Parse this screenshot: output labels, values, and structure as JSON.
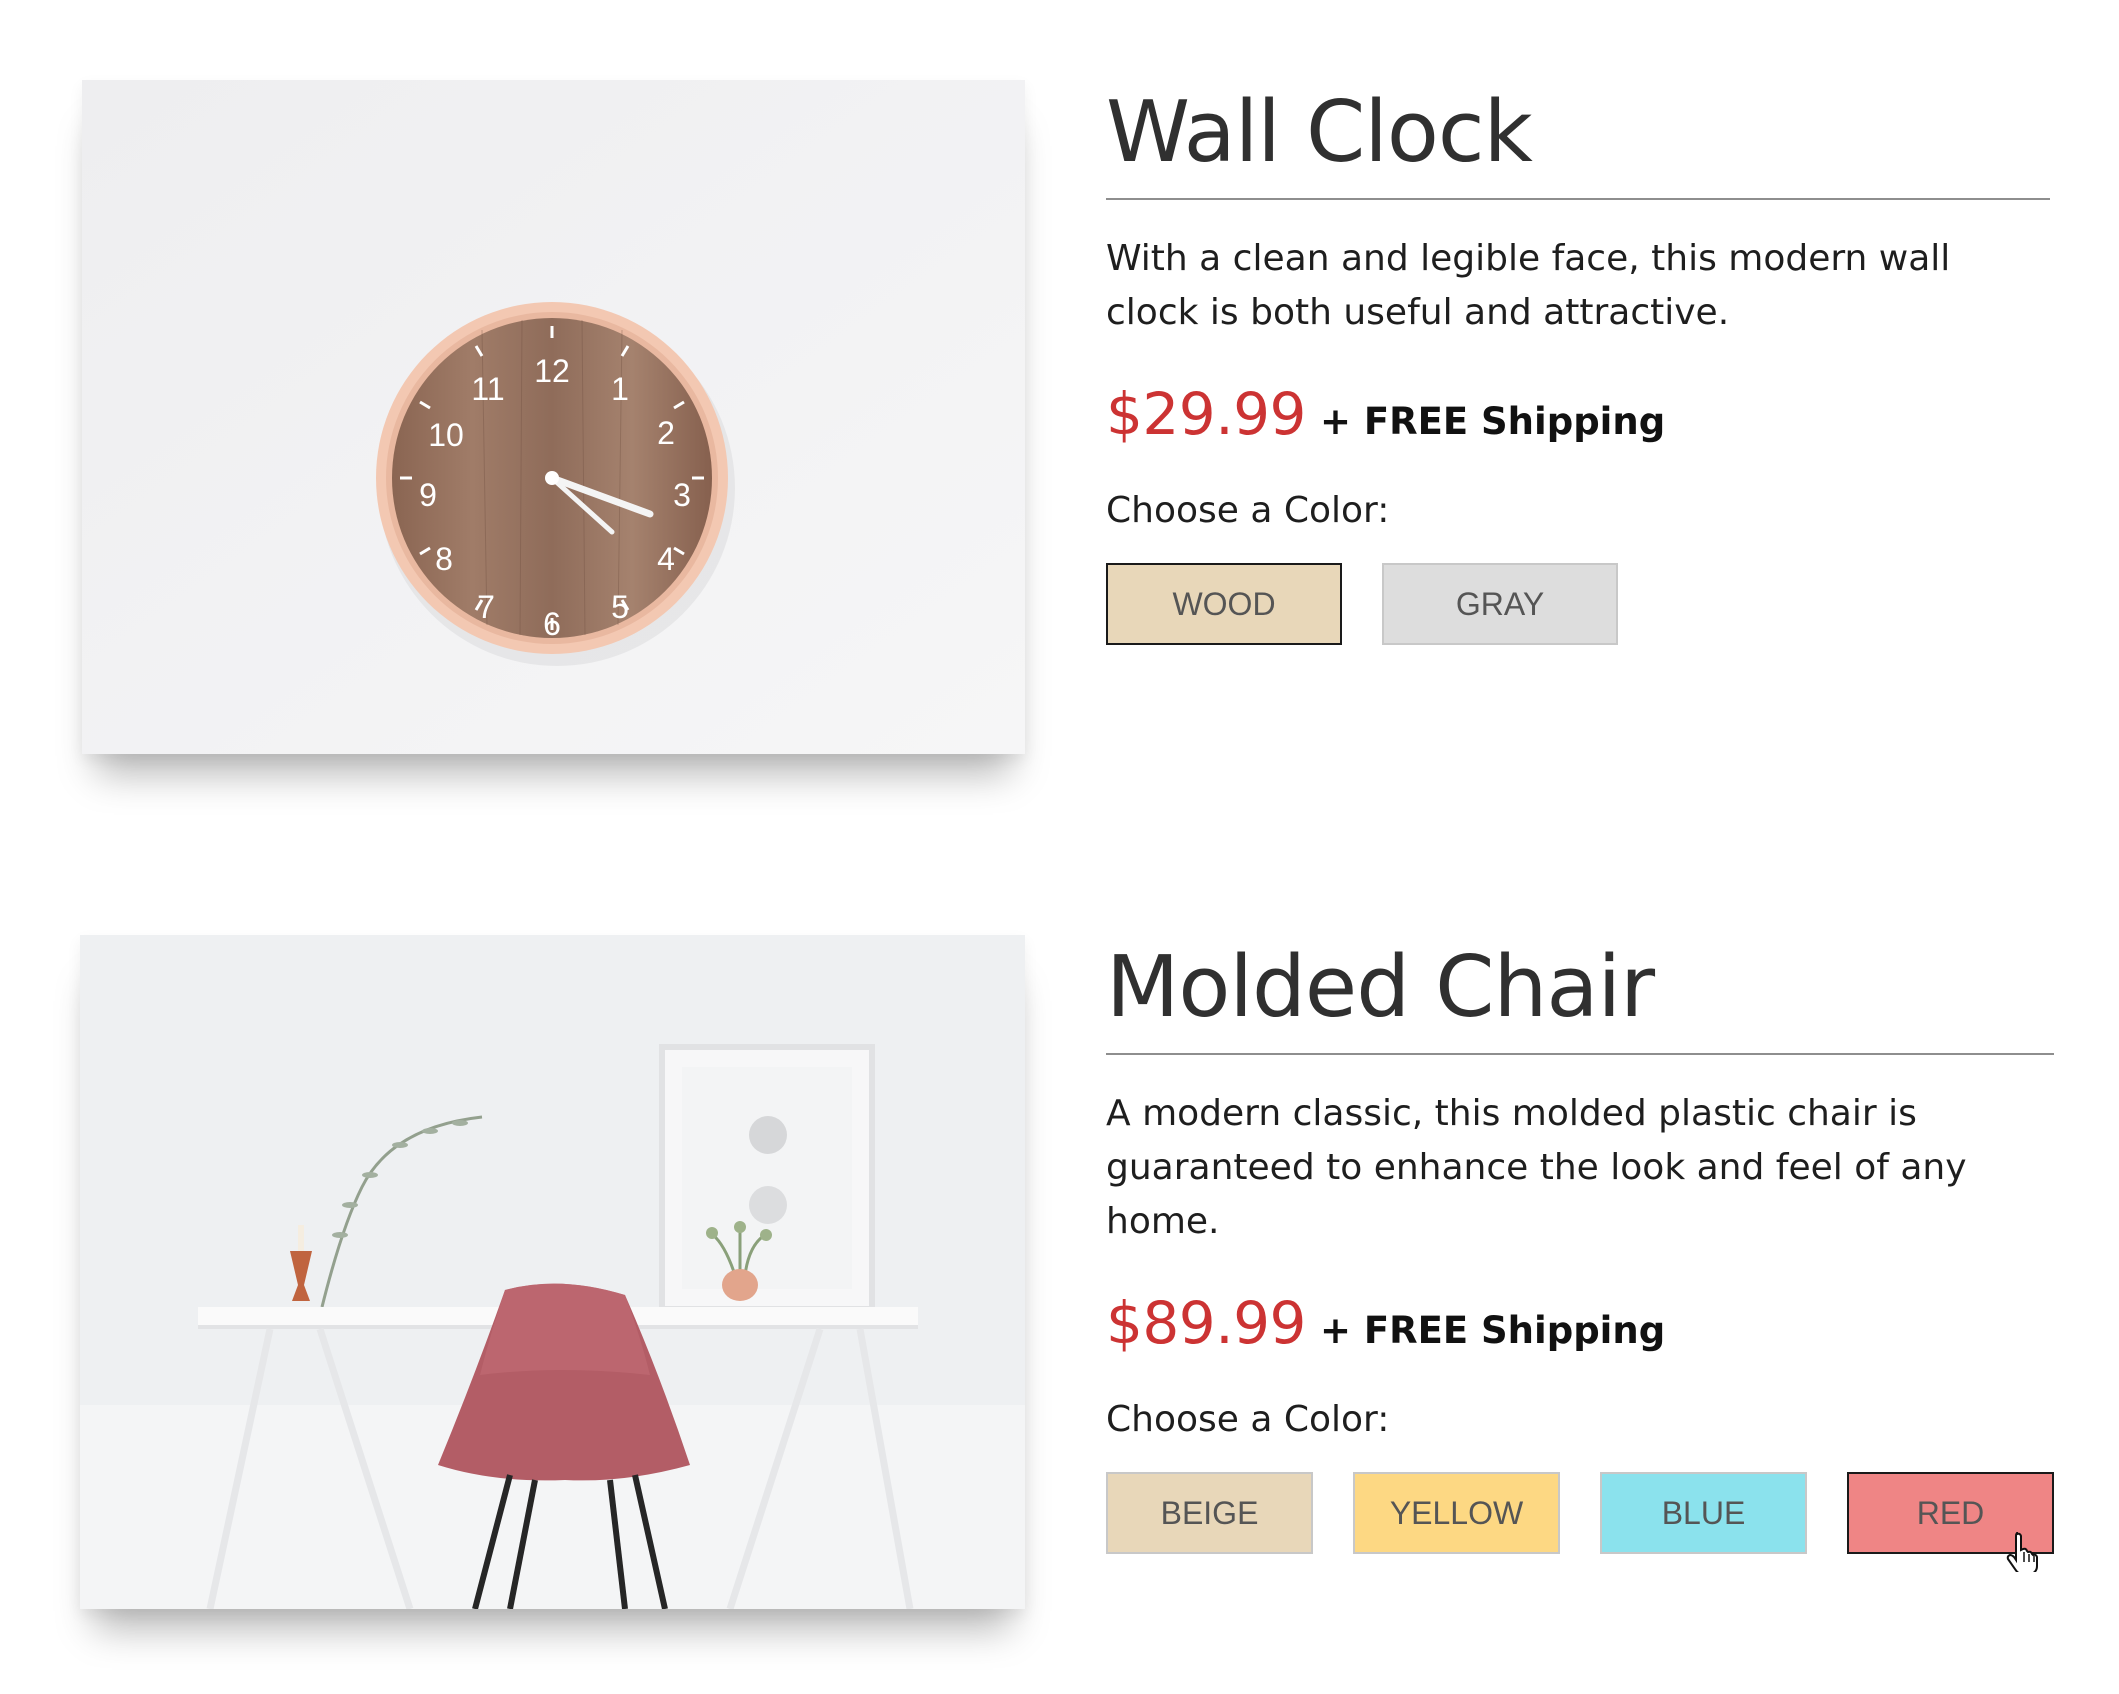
{
  "products": [
    {
      "title": "Wall Clock",
      "description": "With a clean and legible face, this modern wall clock is both useful and attractive.",
      "price": "$29.99",
      "shipping": "+ FREE Shipping",
      "choose_label": "Choose a Color:",
      "colors": [
        {
          "label": "WOOD",
          "color": "#e8d7b9",
          "selected": true
        },
        {
          "label": "GRAY",
          "color": "#dddddd",
          "selected": false
        }
      ],
      "image_icon": "wall-clock-photo"
    },
    {
      "title": "Molded Chair",
      "description": "A modern classic, this molded plastic chair is guaranteed to enhance the look and feel of any home.",
      "price": "$89.99",
      "shipping": "+ FREE Shipping",
      "choose_label": "Choose a Color:",
      "colors": [
        {
          "label": "BEIGE",
          "color": "#e8d7b9",
          "selected": false
        },
        {
          "label": "YELLOW",
          "color": "#fdd883",
          "selected": false
        },
        {
          "label": "BLUE",
          "color": "#8be2ed",
          "selected": false
        },
        {
          "label": "RED",
          "color": "#ef8585",
          "selected": true
        }
      ],
      "image_icon": "molded-chair-photo"
    }
  ],
  "colors": {
    "price": "#cc3333",
    "title": "#303030",
    "rule": "#8e8e8e"
  }
}
